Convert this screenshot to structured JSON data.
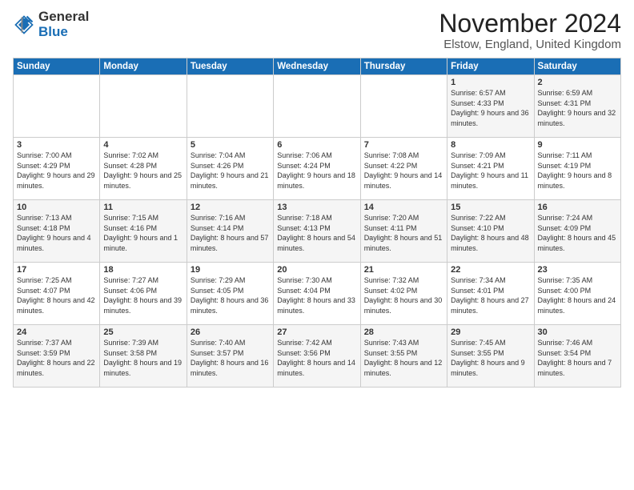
{
  "header": {
    "logo_general": "General",
    "logo_blue": "Blue",
    "month_title": "November 2024",
    "location": "Elstow, England, United Kingdom"
  },
  "columns": [
    "Sunday",
    "Monday",
    "Tuesday",
    "Wednesday",
    "Thursday",
    "Friday",
    "Saturday"
  ],
  "weeks": [
    [
      {
        "day": "",
        "info": ""
      },
      {
        "day": "",
        "info": ""
      },
      {
        "day": "",
        "info": ""
      },
      {
        "day": "",
        "info": ""
      },
      {
        "day": "",
        "info": ""
      },
      {
        "day": "1",
        "info": "Sunrise: 6:57 AM\nSunset: 4:33 PM\nDaylight: 9 hours and 36 minutes."
      },
      {
        "day": "2",
        "info": "Sunrise: 6:59 AM\nSunset: 4:31 PM\nDaylight: 9 hours and 32 minutes."
      }
    ],
    [
      {
        "day": "3",
        "info": "Sunrise: 7:00 AM\nSunset: 4:29 PM\nDaylight: 9 hours and 29 minutes."
      },
      {
        "day": "4",
        "info": "Sunrise: 7:02 AM\nSunset: 4:28 PM\nDaylight: 9 hours and 25 minutes."
      },
      {
        "day": "5",
        "info": "Sunrise: 7:04 AM\nSunset: 4:26 PM\nDaylight: 9 hours and 21 minutes."
      },
      {
        "day": "6",
        "info": "Sunrise: 7:06 AM\nSunset: 4:24 PM\nDaylight: 9 hours and 18 minutes."
      },
      {
        "day": "7",
        "info": "Sunrise: 7:08 AM\nSunset: 4:22 PM\nDaylight: 9 hours and 14 minutes."
      },
      {
        "day": "8",
        "info": "Sunrise: 7:09 AM\nSunset: 4:21 PM\nDaylight: 9 hours and 11 minutes."
      },
      {
        "day": "9",
        "info": "Sunrise: 7:11 AM\nSunset: 4:19 PM\nDaylight: 9 hours and 8 minutes."
      }
    ],
    [
      {
        "day": "10",
        "info": "Sunrise: 7:13 AM\nSunset: 4:18 PM\nDaylight: 9 hours and 4 minutes."
      },
      {
        "day": "11",
        "info": "Sunrise: 7:15 AM\nSunset: 4:16 PM\nDaylight: 9 hours and 1 minute."
      },
      {
        "day": "12",
        "info": "Sunrise: 7:16 AM\nSunset: 4:14 PM\nDaylight: 8 hours and 57 minutes."
      },
      {
        "day": "13",
        "info": "Sunrise: 7:18 AM\nSunset: 4:13 PM\nDaylight: 8 hours and 54 minutes."
      },
      {
        "day": "14",
        "info": "Sunrise: 7:20 AM\nSunset: 4:11 PM\nDaylight: 8 hours and 51 minutes."
      },
      {
        "day": "15",
        "info": "Sunrise: 7:22 AM\nSunset: 4:10 PM\nDaylight: 8 hours and 48 minutes."
      },
      {
        "day": "16",
        "info": "Sunrise: 7:24 AM\nSunset: 4:09 PM\nDaylight: 8 hours and 45 minutes."
      }
    ],
    [
      {
        "day": "17",
        "info": "Sunrise: 7:25 AM\nSunset: 4:07 PM\nDaylight: 8 hours and 42 minutes."
      },
      {
        "day": "18",
        "info": "Sunrise: 7:27 AM\nSunset: 4:06 PM\nDaylight: 8 hours and 39 minutes."
      },
      {
        "day": "19",
        "info": "Sunrise: 7:29 AM\nSunset: 4:05 PM\nDaylight: 8 hours and 36 minutes."
      },
      {
        "day": "20",
        "info": "Sunrise: 7:30 AM\nSunset: 4:04 PM\nDaylight: 8 hours and 33 minutes."
      },
      {
        "day": "21",
        "info": "Sunrise: 7:32 AM\nSunset: 4:02 PM\nDaylight: 8 hours and 30 minutes."
      },
      {
        "day": "22",
        "info": "Sunrise: 7:34 AM\nSunset: 4:01 PM\nDaylight: 8 hours and 27 minutes."
      },
      {
        "day": "23",
        "info": "Sunrise: 7:35 AM\nSunset: 4:00 PM\nDaylight: 8 hours and 24 minutes."
      }
    ],
    [
      {
        "day": "24",
        "info": "Sunrise: 7:37 AM\nSunset: 3:59 PM\nDaylight: 8 hours and 22 minutes."
      },
      {
        "day": "25",
        "info": "Sunrise: 7:39 AM\nSunset: 3:58 PM\nDaylight: 8 hours and 19 minutes."
      },
      {
        "day": "26",
        "info": "Sunrise: 7:40 AM\nSunset: 3:57 PM\nDaylight: 8 hours and 16 minutes."
      },
      {
        "day": "27",
        "info": "Sunrise: 7:42 AM\nSunset: 3:56 PM\nDaylight: 8 hours and 14 minutes."
      },
      {
        "day": "28",
        "info": "Sunrise: 7:43 AM\nSunset: 3:55 PM\nDaylight: 8 hours and 12 minutes."
      },
      {
        "day": "29",
        "info": "Sunrise: 7:45 AM\nSunset: 3:55 PM\nDaylight: 8 hours and 9 minutes."
      },
      {
        "day": "30",
        "info": "Sunrise: 7:46 AM\nSunset: 3:54 PM\nDaylight: 8 hours and 7 minutes."
      }
    ]
  ]
}
